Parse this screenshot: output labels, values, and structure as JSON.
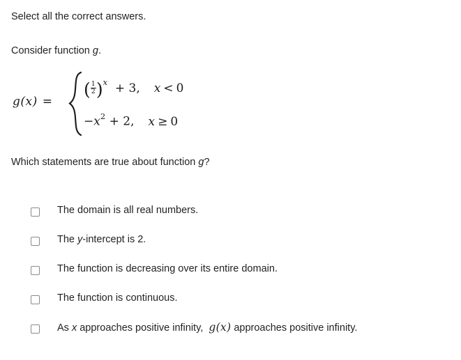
{
  "prompt": {
    "instruction": "Select all the correct answers.",
    "consider_prefix": "Consider function ",
    "consider_variable": "g",
    "consider_suffix": ".",
    "question_prefix": "Which statements are true about function ",
    "question_variable": "g",
    "question_suffix": "?"
  },
  "function_definition": {
    "name": "g",
    "argument": "x",
    "label_fn": "g(x)",
    "label_eq": "=",
    "branches": [
      {
        "base_open": "(",
        "numerator": "1",
        "denominator": "2",
        "base_close": ")",
        "exponent": "x",
        "operator": "+",
        "constant": "3",
        "comma": ",",
        "condition_var": "x",
        "condition_rel": "<",
        "condition_value": "0",
        "expression_text": "(1/2)^x + 3"
      },
      {
        "leading_sign": "−",
        "variable": "x",
        "power": "2",
        "operator": "+",
        "constant": "2",
        "comma": ",",
        "condition_var": "x",
        "condition_rel": "≥",
        "condition_value": "0",
        "expression_text": "-x^2 + 2"
      }
    ]
  },
  "options": [
    {
      "id": "domain-all-reals",
      "checked": false,
      "segments": [
        {
          "text": "The domain is all real numbers.",
          "style": "plain"
        }
      ]
    },
    {
      "id": "y-intercept-is-2",
      "checked": false,
      "segments": [
        {
          "text": "The ",
          "style": "plain"
        },
        {
          "text": "y",
          "style": "italic"
        },
        {
          "text": "-intercept is 2.",
          "style": "plain"
        }
      ]
    },
    {
      "id": "decreasing-entire-domain",
      "checked": false,
      "segments": [
        {
          "text": "The function is decreasing over its entire domain.",
          "style": "plain"
        }
      ]
    },
    {
      "id": "function-continuous",
      "checked": false,
      "segments": [
        {
          "text": "The function is continuous.",
          "style": "plain"
        }
      ]
    },
    {
      "id": "limit-positive-infinity",
      "checked": false,
      "segments": [
        {
          "text": "As ",
          "style": "plain"
        },
        {
          "text": "x",
          "style": "italic"
        },
        {
          "text": " approaches positive infinity,  ",
          "style": "plain"
        },
        {
          "text": "g(x)",
          "style": "math"
        },
        {
          "text": " approaches positive infinity.",
          "style": "plain"
        }
      ]
    }
  ],
  "theme": {
    "background": "#ffffff",
    "text_color": "#231f20",
    "checkbox_border": "#8a8a8a",
    "math_color": "#1a1a1a"
  }
}
